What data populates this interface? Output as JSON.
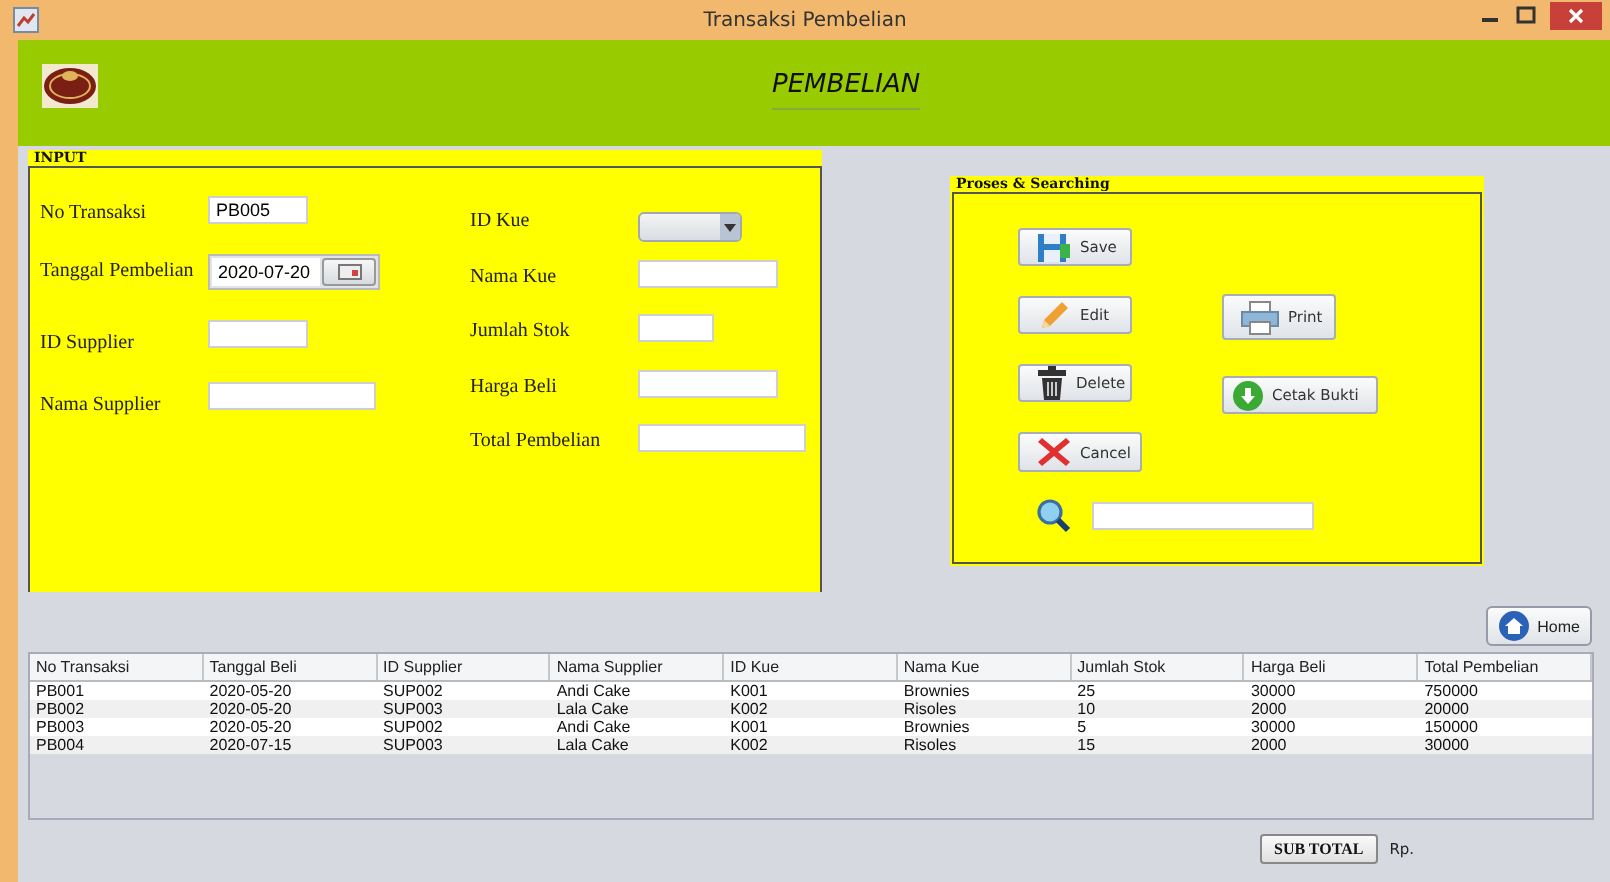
{
  "window": {
    "title": "Transaksi Pembelian"
  },
  "header": {
    "title": "PEMBELIAN"
  },
  "input_panel": {
    "title": "INPUT",
    "left_fields": [
      {
        "label": "No Transaksi",
        "kind": "text",
        "value": "PB005"
      },
      {
        "label": "Tanggal Pembelian",
        "kind": "date",
        "value": "2020-07-20"
      },
      {
        "label": "ID Supplier",
        "kind": "text"
      },
      {
        "label": "Nama Supplier",
        "kind": "text"
      }
    ],
    "right_fields": [
      {
        "label": "ID Kue",
        "kind": "combo"
      },
      {
        "label": "Nama Kue",
        "kind": "text"
      },
      {
        "label": "Jumlah Stok",
        "kind": "text"
      },
      {
        "label": "Harga Beli",
        "kind": "text"
      },
      {
        "label": "Total Pembelian",
        "kind": "text"
      }
    ]
  },
  "process_panel": {
    "title": "Proses & Searching",
    "left_buttons": [
      {
        "label": "Save",
        "kind": "save"
      },
      {
        "label": "Edit",
        "kind": "edit"
      },
      {
        "label": "Delete",
        "kind": "delete"
      },
      {
        "label": "Cancel",
        "kind": "cancel"
      }
    ],
    "right_buttons": [
      {
        "label": "Print",
        "kind": "print"
      },
      {
        "label": "Cetak Bukti",
        "kind": "download"
      }
    ]
  },
  "home_button": {
    "label": "Home"
  },
  "table": {
    "columns": [
      "No Transaksi",
      "Tanggal Beli",
      "ID Supplier",
      "Nama Supplier",
      "ID Kue",
      "Nama Kue",
      "Jumlah Stok",
      "Harga Beli",
      "Total Pembelian"
    ],
    "rows": [
      [
        "PB001",
        "2020-05-20",
        "SUP002",
        "Andi Cake",
        "K001",
        "Brownies",
        "25",
        "30000",
        "750000"
      ],
      [
        "PB002",
        "2020-05-20",
        "SUP003",
        "Lala Cake",
        "K002",
        "Risoles",
        "10",
        "2000",
        "20000"
      ],
      [
        "PB003",
        "2020-05-20",
        "SUP002",
        "Andi Cake",
        "K001",
        "Brownies",
        "5",
        "30000",
        "150000"
      ],
      [
        "PB004",
        "2020-07-15",
        "SUP003",
        "Lala Cake",
        "K002",
        "Risoles",
        "15",
        "2000",
        "30000"
      ]
    ]
  },
  "footer": {
    "subtotal_button": "SUB TOTAL",
    "currency": "Rp."
  }
}
